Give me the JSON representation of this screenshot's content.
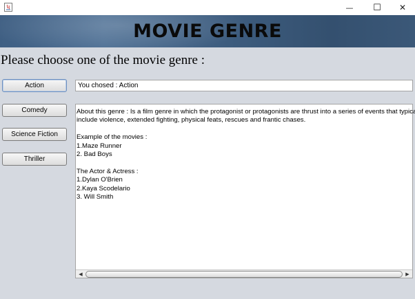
{
  "window": {
    "minimize_glyph": "—",
    "maximize_glyph": "☐",
    "close_glyph": "✕"
  },
  "header": {
    "title": "MOVIE GENRE"
  },
  "prompt": "Please choose one of the movie genre :",
  "genres": [
    {
      "label": "Action"
    },
    {
      "label": "Comedy"
    },
    {
      "label": "Science Fiction"
    },
    {
      "label": "Thriller"
    }
  ],
  "chosen_text": "You chosed : Action",
  "details": {
    "lines": [
      "About this genre : Is a film genre in which the protagonist or protagonists are thrust into a series of events that typically",
      "include violence, extended fighting, physical feats, rescues and frantic chases.",
      "",
      "Example of the movies :",
      "1.Maze Runner",
      "2. Bad Boys",
      "",
      "The Actor & Actress :",
      "1.Dylan O'Brien",
      "2.Kaya Scodelario",
      "3. Will Smith"
    ]
  },
  "scrollbar": {
    "left_arrow": "◀",
    "right_arrow": "▶"
  }
}
